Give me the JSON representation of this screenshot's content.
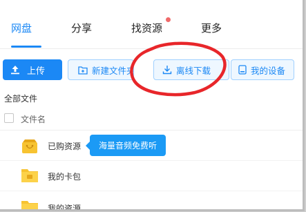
{
  "nav": {
    "tabs": [
      {
        "label": "网盘",
        "active": true
      },
      {
        "label": "分享",
        "active": false
      },
      {
        "label": "找资源",
        "active": false,
        "has_notification": true
      },
      {
        "label": "更多",
        "active": false
      }
    ]
  },
  "toolbar": {
    "upload_label": "上传",
    "new_folder_label": "新建文件夹",
    "offline_download_label": "离线下载",
    "my_devices_label": "我的设备"
  },
  "file_browser": {
    "breadcrumb": "全部文件",
    "column_filename": "文件名",
    "rows": [
      {
        "name": "已购资源",
        "icon": "purchased-folder-icon"
      },
      {
        "name": "我的卡包",
        "icon": "folder-icon"
      },
      {
        "name": "我的资源",
        "icon": "folder-icon"
      }
    ]
  },
  "tooltip": {
    "text": "海量音频免费听"
  },
  "colors": {
    "accent": "#1b88f5",
    "folder": "#f7c331",
    "notification": "#f06a6a",
    "annotation_circle": "#e8262a"
  }
}
